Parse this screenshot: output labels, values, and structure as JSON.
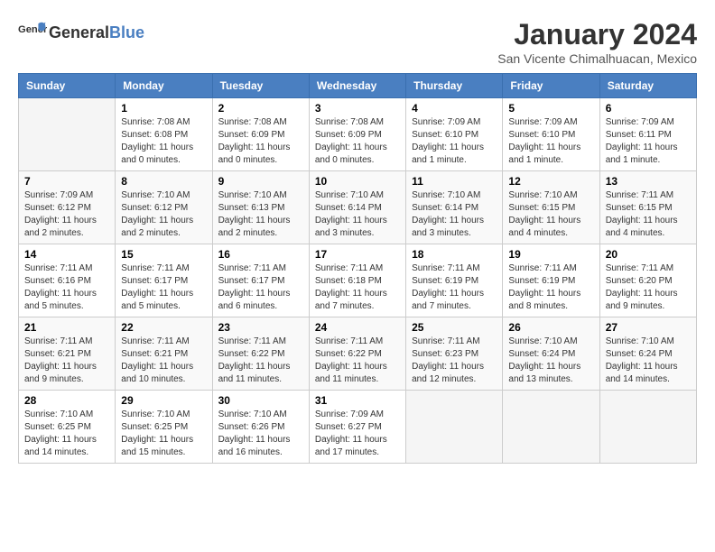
{
  "header": {
    "logo_general": "General",
    "logo_blue": "Blue",
    "month_year": "January 2024",
    "location": "San Vicente Chimalhuacan, Mexico"
  },
  "weekdays": [
    "Sunday",
    "Monday",
    "Tuesday",
    "Wednesday",
    "Thursday",
    "Friday",
    "Saturday"
  ],
  "weeks": [
    [
      {
        "day": "",
        "empty": true
      },
      {
        "day": "1",
        "sunrise": "7:08 AM",
        "sunset": "6:08 PM",
        "daylight": "11 hours and 0 minutes."
      },
      {
        "day": "2",
        "sunrise": "7:08 AM",
        "sunset": "6:09 PM",
        "daylight": "11 hours and 0 minutes."
      },
      {
        "day": "3",
        "sunrise": "7:08 AM",
        "sunset": "6:09 PM",
        "daylight": "11 hours and 0 minutes."
      },
      {
        "day": "4",
        "sunrise": "7:09 AM",
        "sunset": "6:10 PM",
        "daylight": "11 hours and 1 minute."
      },
      {
        "day": "5",
        "sunrise": "7:09 AM",
        "sunset": "6:10 PM",
        "daylight": "11 hours and 1 minute."
      },
      {
        "day": "6",
        "sunrise": "7:09 AM",
        "sunset": "6:11 PM",
        "daylight": "11 hours and 1 minute."
      }
    ],
    [
      {
        "day": "7",
        "sunrise": "7:09 AM",
        "sunset": "6:12 PM",
        "daylight": "11 hours and 2 minutes."
      },
      {
        "day": "8",
        "sunrise": "7:10 AM",
        "sunset": "6:12 PM",
        "daylight": "11 hours and 2 minutes."
      },
      {
        "day": "9",
        "sunrise": "7:10 AM",
        "sunset": "6:13 PM",
        "daylight": "11 hours and 2 minutes."
      },
      {
        "day": "10",
        "sunrise": "7:10 AM",
        "sunset": "6:14 PM",
        "daylight": "11 hours and 3 minutes."
      },
      {
        "day": "11",
        "sunrise": "7:10 AM",
        "sunset": "6:14 PM",
        "daylight": "11 hours and 3 minutes."
      },
      {
        "day": "12",
        "sunrise": "7:10 AM",
        "sunset": "6:15 PM",
        "daylight": "11 hours and 4 minutes."
      },
      {
        "day": "13",
        "sunrise": "7:11 AM",
        "sunset": "6:15 PM",
        "daylight": "11 hours and 4 minutes."
      }
    ],
    [
      {
        "day": "14",
        "sunrise": "7:11 AM",
        "sunset": "6:16 PM",
        "daylight": "11 hours and 5 minutes."
      },
      {
        "day": "15",
        "sunrise": "7:11 AM",
        "sunset": "6:17 PM",
        "daylight": "11 hours and 5 minutes."
      },
      {
        "day": "16",
        "sunrise": "7:11 AM",
        "sunset": "6:17 PM",
        "daylight": "11 hours and 6 minutes."
      },
      {
        "day": "17",
        "sunrise": "7:11 AM",
        "sunset": "6:18 PM",
        "daylight": "11 hours and 7 minutes."
      },
      {
        "day": "18",
        "sunrise": "7:11 AM",
        "sunset": "6:19 PM",
        "daylight": "11 hours and 7 minutes."
      },
      {
        "day": "19",
        "sunrise": "7:11 AM",
        "sunset": "6:19 PM",
        "daylight": "11 hours and 8 minutes."
      },
      {
        "day": "20",
        "sunrise": "7:11 AM",
        "sunset": "6:20 PM",
        "daylight": "11 hours and 9 minutes."
      }
    ],
    [
      {
        "day": "21",
        "sunrise": "7:11 AM",
        "sunset": "6:21 PM",
        "daylight": "11 hours and 9 minutes."
      },
      {
        "day": "22",
        "sunrise": "7:11 AM",
        "sunset": "6:21 PM",
        "daylight": "11 hours and 10 minutes."
      },
      {
        "day": "23",
        "sunrise": "7:11 AM",
        "sunset": "6:22 PM",
        "daylight": "11 hours and 11 minutes."
      },
      {
        "day": "24",
        "sunrise": "7:11 AM",
        "sunset": "6:22 PM",
        "daylight": "11 hours and 11 minutes."
      },
      {
        "day": "25",
        "sunrise": "7:11 AM",
        "sunset": "6:23 PM",
        "daylight": "11 hours and 12 minutes."
      },
      {
        "day": "26",
        "sunrise": "7:10 AM",
        "sunset": "6:24 PM",
        "daylight": "11 hours and 13 minutes."
      },
      {
        "day": "27",
        "sunrise": "7:10 AM",
        "sunset": "6:24 PM",
        "daylight": "11 hours and 14 minutes."
      }
    ],
    [
      {
        "day": "28",
        "sunrise": "7:10 AM",
        "sunset": "6:25 PM",
        "daylight": "11 hours and 14 minutes."
      },
      {
        "day": "29",
        "sunrise": "7:10 AM",
        "sunset": "6:25 PM",
        "daylight": "11 hours and 15 minutes."
      },
      {
        "day": "30",
        "sunrise": "7:10 AM",
        "sunset": "6:26 PM",
        "daylight": "11 hours and 16 minutes."
      },
      {
        "day": "31",
        "sunrise": "7:09 AM",
        "sunset": "6:27 PM",
        "daylight": "11 hours and 17 minutes."
      },
      {
        "day": "",
        "empty": true
      },
      {
        "day": "",
        "empty": true
      },
      {
        "day": "",
        "empty": true
      }
    ]
  ],
  "labels": {
    "sunrise_prefix": "Sunrise: ",
    "sunset_prefix": "Sunset: ",
    "daylight_prefix": "Daylight: "
  }
}
